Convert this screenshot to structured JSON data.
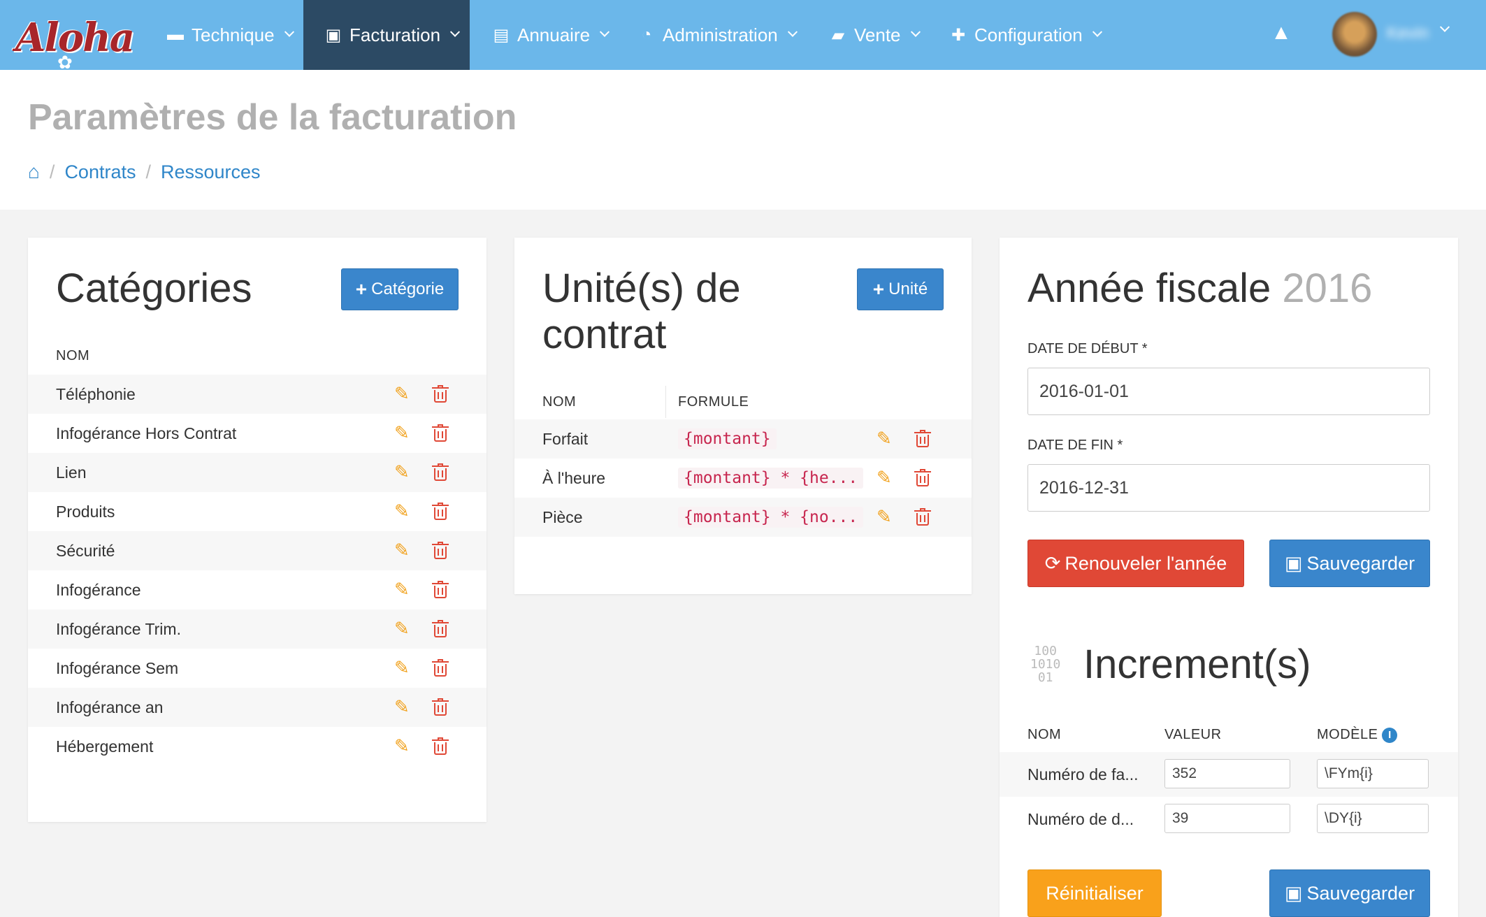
{
  "nav": {
    "logo": "Aloha",
    "items": [
      {
        "label": "Technique",
        "icon": "toolbox-icon"
      },
      {
        "label": "Facturation",
        "icon": "money-icon"
      },
      {
        "label": "Annuaire",
        "icon": "book-icon"
      },
      {
        "label": "Administration",
        "icon": "dashboard-icon"
      },
      {
        "label": "Vente",
        "icon": "truck-icon"
      },
      {
        "label": "Configuration",
        "icon": "puzzle-icon"
      }
    ],
    "active": "Facturation",
    "warning_icon": "warning-icon",
    "user_name": "Kevin"
  },
  "header": {
    "title": "Paramètres de la facturation",
    "breadcrumb": [
      "Contrats",
      "Ressources"
    ]
  },
  "categories": {
    "title": "Catégories",
    "add_label": "Catégorie",
    "col_name": "NOM",
    "rows": [
      "Téléphonie",
      "Infogérance Hors Contrat",
      "Lien",
      "Produits",
      "Sécurité",
      "Infogérance",
      "Infogérance Trim.",
      "Infogérance Sem",
      "Infogérance an",
      "Hébergement"
    ]
  },
  "units": {
    "title_line1": "Unité(s) de",
    "title_line2": "contrat",
    "add_label": "Unité",
    "col_name": "NOM",
    "col_formula": "FORMULE",
    "rows": [
      {
        "name": "Forfait",
        "formula": "{montant}"
      },
      {
        "name": "À l'heure",
        "formula": "{montant} * {he..."
      },
      {
        "name": "Pièce",
        "formula": "{montant} * {no..."
      }
    ]
  },
  "fiscal": {
    "title": "Année fiscale",
    "year": "2016",
    "start_label": "DATE DE DÉBUT *",
    "start_value": "2016-01-01",
    "end_label": "DATE DE FIN *",
    "end_value": "2016-12-31",
    "renew_label": "Renouveler l'année",
    "save_label": "Sauvegarder"
  },
  "increments": {
    "title": "Increment(s)",
    "icon_text": [
      "100",
      "1010",
      "01"
    ],
    "col_name": "NOM",
    "col_value": "VALEUR",
    "col_model": "MODÈLE",
    "rows": [
      {
        "name": "Numéro de fa...",
        "value": "352",
        "model": "\\FYm{i}"
      },
      {
        "name": "Numéro de d...",
        "value": "39",
        "model": "\\DY{i}"
      }
    ],
    "reset_label": "Réinitialiser",
    "save_label": "Sauvegarder"
  }
}
